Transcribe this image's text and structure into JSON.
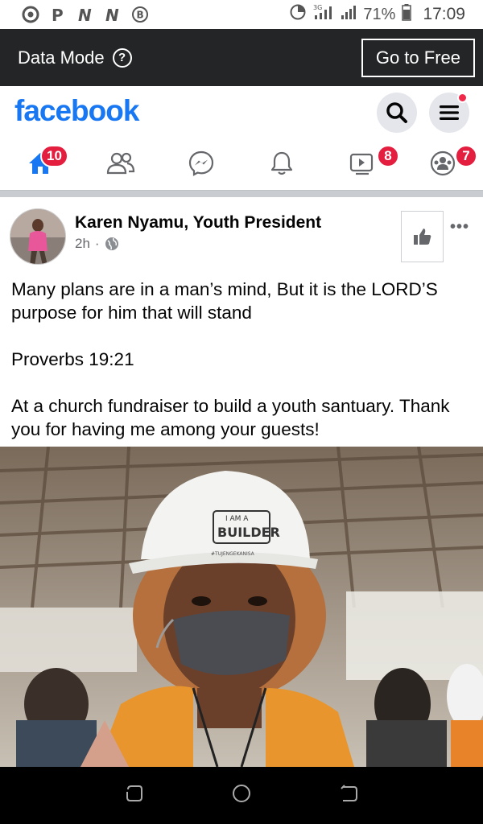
{
  "status_bar": {
    "left_icons": [
      "chrome-icon",
      "pinterest-icon",
      "n-icon",
      "n-icon",
      "b-icon"
    ],
    "network": "3G",
    "battery": "71%",
    "time": "17:09"
  },
  "data_mode": {
    "label": "Data Mode",
    "button": "Go to Free"
  },
  "header": {
    "logo": "facebook",
    "brand_color": "#1877f2"
  },
  "nav": {
    "home_badge": "10",
    "watch_badge": "8",
    "groups_badge": "7"
  },
  "post": {
    "author": "Karen Nyamu, Youth President",
    "time": "2h",
    "separator": "·",
    "more": "•••",
    "paragraphs": [
      "Many plans are in a man’s mind, But it is the LORD’S purpose for him that will stand",
      "Proverbs 19:21",
      "At a church fundraiser to build a youth santuary. Thank you for having me among your guests!"
    ],
    "helmet_text_line1": "I AM A",
    "helmet_text_line2": "BUILDER",
    "helmet_hashtag": "#TUJENGEKANISA"
  }
}
